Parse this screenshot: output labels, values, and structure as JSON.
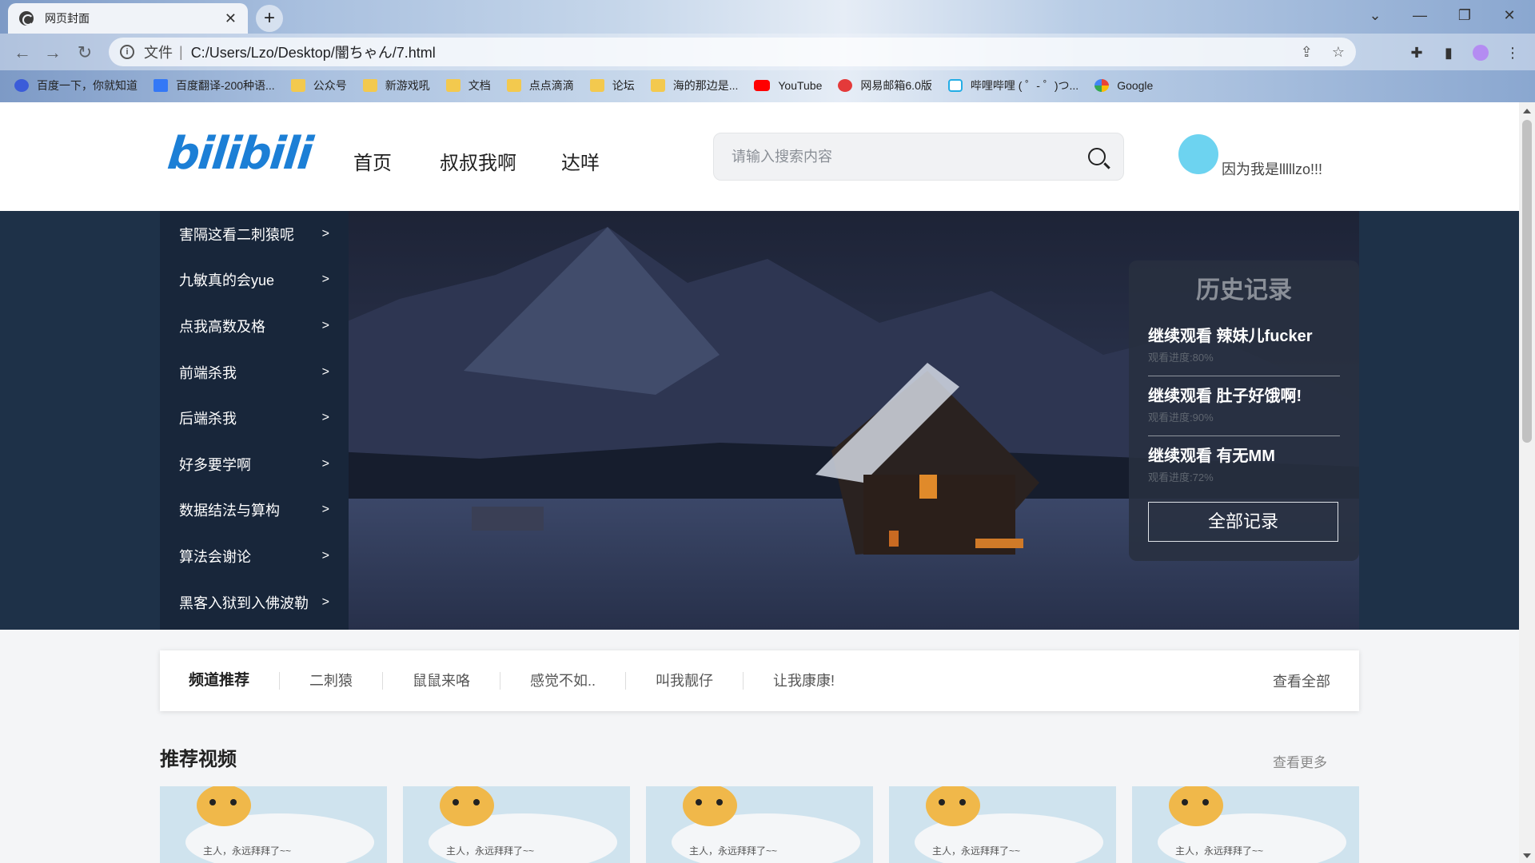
{
  "browser": {
    "tab_title": "网页封面",
    "tab_close": "✕",
    "new_tab": "+",
    "url_label": "文件",
    "url_separator": "|",
    "url": "C:/Users/Lzo/Desktop/闇ちゃん/7.html",
    "window_controls": [
      "⌄",
      "—",
      "❐",
      "✕"
    ],
    "bookmarks": [
      {
        "label": "百度一下，你就知道",
        "icon": "baidu-icon"
      },
      {
        "label": "百度翻译-200种语...",
        "icon": "fanyi-icon"
      },
      {
        "label": "公众号",
        "icon": "folder-icon"
      },
      {
        "label": "新游戏吼",
        "icon": "folder-icon"
      },
      {
        "label": "文档",
        "icon": "folder-icon"
      },
      {
        "label": "点点滴滴",
        "icon": "folder-icon"
      },
      {
        "label": "论坛",
        "icon": "folder-icon"
      },
      {
        "label": "海的那边是...",
        "icon": "folder-icon"
      },
      {
        "label": "YouTube",
        "icon": "youtube-icon"
      },
      {
        "label": "网易邮箱6.0版",
        "icon": "mail-icon"
      },
      {
        "label": "哔哩哔哩 ( ゜- ゜)つ...",
        "icon": "bilibili-icon"
      },
      {
        "label": "Google",
        "icon": "google-icon"
      }
    ]
  },
  "header": {
    "logo": "bilibili",
    "nav": [
      "首页",
      "叔叔我啊",
      "达咩"
    ],
    "search_placeholder": "请输入搜索内容",
    "username": "因为我是lllllzo!!!",
    "avatar_color": "#6dd3f0"
  },
  "side_menu": [
    {
      "label": "害隔这看二刺猿呢",
      "arrow": ">"
    },
    {
      "label": "九敏真的会yue",
      "arrow": ">"
    },
    {
      "label": "点我高数及格",
      "arrow": ">"
    },
    {
      "label": "前端杀我",
      "arrow": ">"
    },
    {
      "label": "后端杀我",
      "arrow": ">"
    },
    {
      "label": "好多要学啊",
      "arrow": ">"
    },
    {
      "label": "数据结法与算构",
      "arrow": ">"
    },
    {
      "label": "算法会谢论",
      "arrow": ">"
    },
    {
      "label": "黑客入狱到入佛波勒",
      "arrow": ">"
    }
  ],
  "history": {
    "title": "历史记录",
    "records": [
      {
        "title": "继续观看 辣妹儿fucker",
        "progress": "观看进度:80%"
      },
      {
        "title": "继续观看 肚子好饿啊!",
        "progress": "观看进度:90%"
      },
      {
        "title": "继续观看 有无MM",
        "progress": "观看进度:72%"
      }
    ],
    "all_button": "全部记录"
  },
  "channel": {
    "items": [
      "频道推荐",
      "二刺猿",
      "鼠鼠来咯",
      "感觉不如..",
      "叫我靓仔",
      "让我康康!"
    ],
    "view_all": "查看全部"
  },
  "recommend": {
    "title": "推荐视频",
    "more": "查看更多",
    "cards": [
      {
        "caption": "主人，永远拜拜了~~"
      },
      {
        "caption": "主人，永远拜拜了~~"
      },
      {
        "caption": "主人，永远拜拜了~~"
      },
      {
        "caption": "主人，永远拜拜了~~"
      },
      {
        "caption": "主人，永远拜拜了~~"
      }
    ]
  },
  "colors": {
    "banner_bg": "#1e3148",
    "side_menu_bg": "#18263a",
    "brand_blue": "#1c7fd6"
  }
}
